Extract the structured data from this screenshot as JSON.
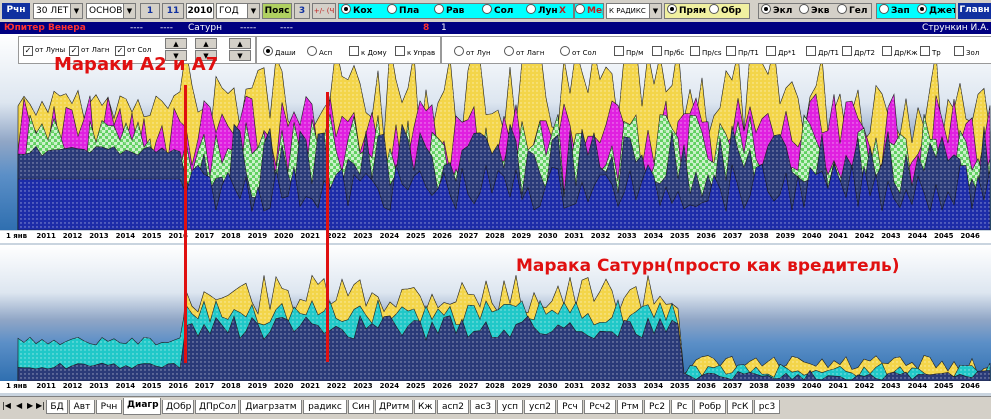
{
  "toolbar": {
    "rch": "Рчн",
    "period": "30 ЛЕТ",
    "base": "ОСНОВН",
    "num1": "1",
    "num2": "11",
    "year": "2010",
    "unit": "ГОД",
    "belt": "Пояс",
    "num3": "3",
    "plusminus": "+/- (Ч",
    "grp1": [
      "Кох",
      "Пла",
      "Рав",
      "Сол",
      "Лун"
    ],
    "x": "X",
    "mer": "Мер",
    "radix": "К РАДИКС",
    "grp2": [
      "Прям",
      "Обр"
    ],
    "grp3": [
      "Экл",
      "Экв",
      "Гел"
    ],
    "grp4": [
      "Зап",
      "Джет"
    ],
    "main": "Главн"
  },
  "infoRow": {
    "left": "Юпитер Венера",
    "d1": "----",
    "d2": "----",
    "saturn": "Сатурн",
    "d3": "-----",
    "d4": "----",
    "n8": "8",
    "n1": "1",
    "author": "Стрункин И.А."
  },
  "options": {
    "left": [
      {
        "label": "от Луны",
        "checked": true
      },
      {
        "label": "от Лагн",
        "checked": true
      },
      {
        "label": "от Сол",
        "checked": true
      }
    ],
    "mid": [
      {
        "label": "Даши",
        "kind": "radio",
        "on": true
      },
      {
        "label": "Асп",
        "kind": "radio",
        "on": false
      },
      {
        "label": "к Дому",
        "kind": "check",
        "on": false
      },
      {
        "label": "к Управ",
        "kind": "check",
        "on": false
      }
    ],
    "right": [
      {
        "label": "от Лун",
        "kind": "radio"
      },
      {
        "label": "от Лагн",
        "kind": "radio"
      },
      {
        "label": "от Сол",
        "kind": "radio"
      },
      {
        "label": "Пр/м",
        "kind": "check"
      },
      {
        "label": "Пр/бс",
        "kind": "check"
      },
      {
        "label": "Пр/сs",
        "kind": "check"
      },
      {
        "label": "Пр/Т1",
        "kind": "check"
      },
      {
        "label": "Др*1",
        "kind": "check"
      },
      {
        "label": "Др/Т1",
        "kind": "check"
      },
      {
        "label": "Др/Т2",
        "kind": "check"
      },
      {
        "label": "Др/Кж",
        "kind": "check"
      },
      {
        "label": "Тр",
        "kind": "check"
      },
      {
        "label": "Зол",
        "kind": "check"
      }
    ]
  },
  "years": [
    "1 янв",
    "2011",
    "2012",
    "2013",
    "2014",
    "2015",
    "2016",
    "2017",
    "2018",
    "2019",
    "2020",
    "2021",
    "2022",
    "2023",
    "2024",
    "2025",
    "2026",
    "2027",
    "2028",
    "2029",
    "2030",
    "2031",
    "2032",
    "2033",
    "2034",
    "2035",
    "2036",
    "2037",
    "2038",
    "2039",
    "2040",
    "2041",
    "2042",
    "2043",
    "2044",
    "2045",
    "2046"
  ],
  "annotations": {
    "top": "Мараки А2 и А7",
    "bottom": "Марака Сатурн(просто как вредитель)"
  },
  "tabs": [
    "БД",
    "Авт",
    "Рчн",
    "Диагр",
    "ДОбр",
    "ДПрСол",
    "Диагрзатм",
    "радикс",
    "Син",
    "ДРитм",
    "Кж",
    "асп2",
    "ас3",
    "усп",
    "усп2",
    "Рсч",
    "Рсч2",
    "Ртм",
    "Рс2",
    "Рс",
    "Робр",
    "РсК",
    "рс3"
  ],
  "activeTab": "Диагр",
  "colors": {
    "navy": "#000080",
    "accentRed": "#e01010",
    "cyan": "#00ffff",
    "yellow": "#f3d54a",
    "magenta": "#e020e0",
    "green": "#40d040",
    "darkBlue": "#1d2ca8",
    "slate": "#2a3a78",
    "teal": "#20c8c8"
  }
}
